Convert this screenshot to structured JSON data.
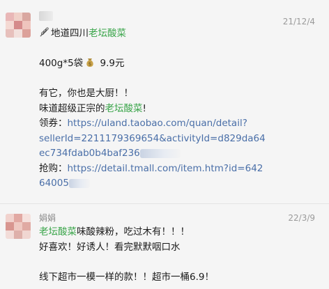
{
  "messages": [
    {
      "sender": "",
      "time": "21/12/4",
      "lines": {
        "title_prefix": "地道四川",
        "title_highlight": "老坛酸菜",
        "price_prefix": "400g*5袋",
        "price_suffix": "9.9元",
        "line3": "有它，你也是大厨！！",
        "line4_prefix": "味道超级正宗的",
        "line4_highlight": "老坛酸菜",
        "line4_suffix": "!",
        "coupon_label": "领券：",
        "coupon_url_1": "https://uland.taobao.com/quan/detail?",
        "coupon_url_2": "sellerId=2211179369654&activityId=d829da64",
        "coupon_url_3": "ec734fdab0b4baf236",
        "buy_label": "抢购：",
        "buy_url_1": "https://detail.tmall.com/item.htm?id=642",
        "buy_url_2": "64005"
      },
      "icons": [
        "wheat-icon",
        "money-bag-icon"
      ]
    },
    {
      "sender": "娟娟",
      "time": "22/3/9",
      "lines": {
        "line1_highlight": "老坛酸菜",
        "line1_suffix": "味酸辣粉，吃过木有！！！",
        "line2": "好喜欢！好诱人！看完默默咽口水",
        "line3": "线下超市一模一样的款！！超市一桶6.9！"
      }
    }
  ],
  "colors": {
    "highlight": "#3aa54a",
    "link": "#4a6fa8",
    "time": "#9a9a9a",
    "background": "#f5f5f5"
  }
}
